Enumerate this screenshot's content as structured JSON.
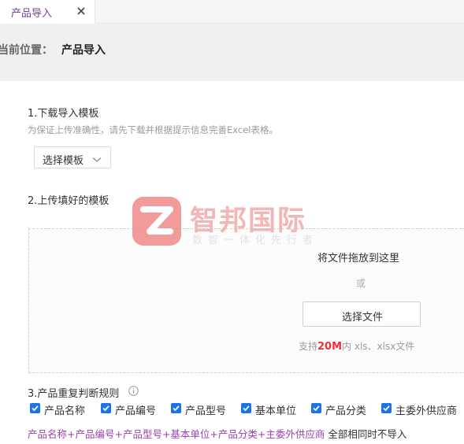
{
  "tab": {
    "label": "产品导入",
    "close_symbol": "×"
  },
  "breadcrumb": {
    "label": "当前位置：",
    "current": "产品导入"
  },
  "step1": {
    "title": "1.下载导入模板",
    "hint": "为保证上传准确性，请先下载并根据提示信息完善Excel表格。",
    "select_label": "选择模板"
  },
  "step2": {
    "title": "2.上传填好的模板",
    "drop_text": "将文件拖放到这里",
    "or_text": "或",
    "choose_button": "选择文件",
    "support_prefix": "支持",
    "support_size": "20M",
    "support_suffix": "内 xls、xlsx文件"
  },
  "watermark": {
    "title": "智邦国际",
    "subtitle": "数智一体化先行者",
    "color": "#e86a6a"
  },
  "step3": {
    "title": "3.产品重复判断规则",
    "checkboxes": [
      {
        "label": "产品名称",
        "checked": true
      },
      {
        "label": "产品编号",
        "checked": true
      },
      {
        "label": "产品型号",
        "checked": true
      },
      {
        "label": "基本单位",
        "checked": true
      },
      {
        "label": "产品分类",
        "checked": true
      },
      {
        "label": "主委外供应商",
        "checked": true
      }
    ],
    "rule_fields": "产品名称+产品编号+产品型号+基本单位+产品分类+主委外供应商",
    "rule_suffix": " 全部相同时不导入"
  },
  "colors": {
    "accent": "#7a3e9d",
    "checkbox": "#1a73e8",
    "highlight": "#e8323c"
  }
}
